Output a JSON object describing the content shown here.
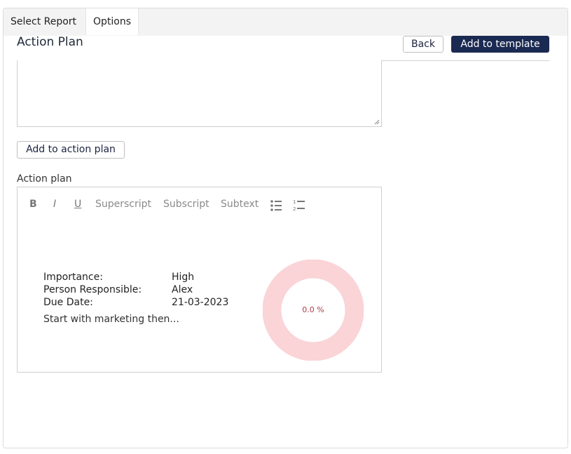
{
  "tabs": [
    {
      "label": "Select Report",
      "active": false
    },
    {
      "label": "Options",
      "active": true
    }
  ],
  "header": {
    "title": "Action Plan",
    "back_label": "Back",
    "add_template_label": "Add to template"
  },
  "textarea": {
    "value": ""
  },
  "add_action_label": "Add to action plan",
  "action_plan_label": "Action plan",
  "toolbar": {
    "bold": "B",
    "italic": "I",
    "underline": "U",
    "superscript": "Superscript",
    "subscript": "Subscript",
    "subtext": "Subtext",
    "bullet_icon": "bulleted-list-icon",
    "number_icon": "numbered-list-icon"
  },
  "plan_item": {
    "importance_label": "Importance:",
    "importance_value": "High",
    "person_label": "Person Responsible:",
    "person_value": "Alex",
    "due_label": "Due Date:",
    "due_value": "21-03-2023",
    "note": "Start with marketing then...",
    "progress_text": "0.0 %",
    "progress_fraction": 0.0
  },
  "colors": {
    "primary": "#1b2a52",
    "donut_track": "#fad4d7",
    "donut_text": "#b23b48"
  }
}
